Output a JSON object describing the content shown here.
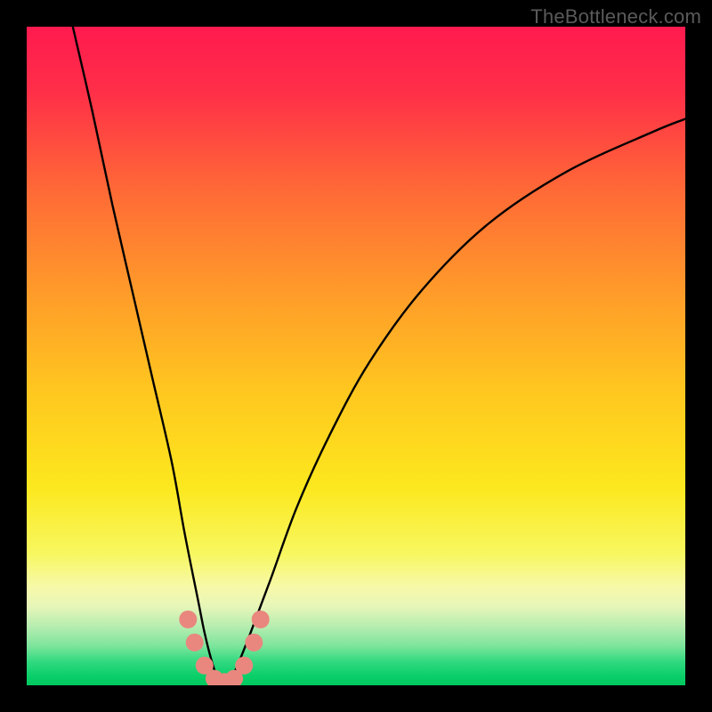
{
  "watermark": "TheBottleneck.com",
  "chart_data": {
    "type": "line",
    "title": "",
    "xlabel": "",
    "ylabel": "",
    "xlim": [
      0,
      100
    ],
    "ylim": [
      0,
      100
    ],
    "grid": false,
    "legend": false,
    "annotations": [],
    "series": [
      {
        "name": "bottleneck-curve",
        "x": [
          7,
          10,
          13,
          16,
          19,
          22,
          24,
          26,
          27,
          28,
          29,
          30,
          31,
          32,
          34,
          37,
          41,
          46,
          52,
          60,
          70,
          82,
          95,
          100
        ],
        "y": [
          100,
          87,
          73,
          60,
          47,
          34,
          23,
          13,
          8,
          4,
          1,
          0,
          1,
          3,
          8,
          16,
          27,
          38,
          49,
          60,
          70,
          78,
          84,
          86
        ]
      }
    ],
    "markers": [
      {
        "x": 24.5,
        "y": 10.0
      },
      {
        "x": 25.5,
        "y": 6.5
      },
      {
        "x": 27.0,
        "y": 3.0
      },
      {
        "x": 28.5,
        "y": 1.0
      },
      {
        "x": 30.0,
        "y": 0.5
      },
      {
        "x": 31.5,
        "y": 1.0
      },
      {
        "x": 33.0,
        "y": 3.0
      },
      {
        "x": 34.5,
        "y": 6.5
      },
      {
        "x": 35.5,
        "y": 10.0
      }
    ],
    "gradient_stops": [
      {
        "pos": 0.0,
        "color": "#ff1a4f"
      },
      {
        "pos": 0.1,
        "color": "#ff2f48"
      },
      {
        "pos": 0.25,
        "color": "#ff6a36"
      },
      {
        "pos": 0.4,
        "color": "#ff9a2a"
      },
      {
        "pos": 0.55,
        "color": "#ffc61f"
      },
      {
        "pos": 0.7,
        "color": "#fce81e"
      },
      {
        "pos": 0.8,
        "color": "#f7f760"
      },
      {
        "pos": 0.85,
        "color": "#f7f9a8"
      },
      {
        "pos": 0.88,
        "color": "#e7f6b8"
      },
      {
        "pos": 0.91,
        "color": "#b7edb0"
      },
      {
        "pos": 0.94,
        "color": "#7de59c"
      },
      {
        "pos": 0.965,
        "color": "#2fd97f"
      },
      {
        "pos": 0.985,
        "color": "#0ccf6a"
      },
      {
        "pos": 1.0,
        "color": "#00c85f"
      }
    ],
    "marker_style": {
      "color": "#e9877e",
      "radius_px": 10
    },
    "curve_style": {
      "stroke": "#000000",
      "stroke_width_px": 2.4
    }
  }
}
